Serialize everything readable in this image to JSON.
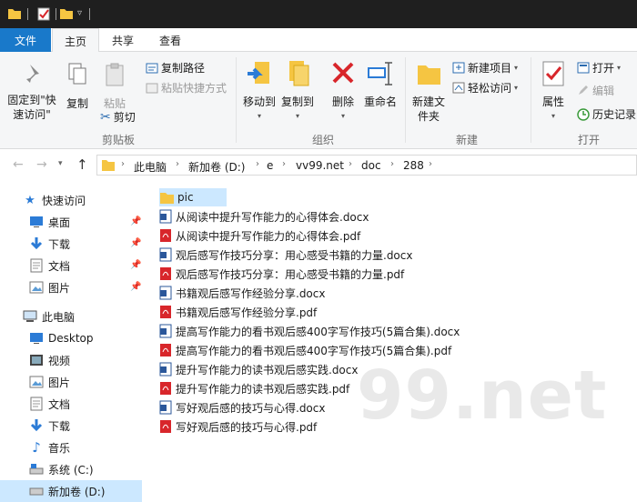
{
  "ribbon_tabs": {
    "file": "文件",
    "home": "主页",
    "share": "共享",
    "view": "查看"
  },
  "ribbon": {
    "pin_quick_access": "固定到\"快速访问\"",
    "copy": "复制",
    "paste": "粘贴",
    "copy_path": "复制路径",
    "paste_shortcut": "粘贴快捷方式",
    "cut": "剪切",
    "clipboard_group": "剪贴板",
    "move_to": "移动到",
    "copy_to": "复制到",
    "delete": "删除",
    "rename": "重命名",
    "organize_group": "组织",
    "new_folder": "新建文件夹",
    "new_item": "新建项目",
    "easy_access": "轻松访问",
    "new_group": "新建",
    "properties": "属性",
    "open": "打开",
    "edit": "编辑",
    "history": "历史记录",
    "open_group": "打开"
  },
  "address": {
    "crumbs": [
      "此电脑",
      "新加卷 (D:)",
      "e",
      "vv99.net",
      "doc",
      "288"
    ]
  },
  "nav": {
    "quick_access": "快速访问",
    "quick_items": [
      "桌面",
      "下载",
      "文档",
      "图片"
    ],
    "this_pc": "此电脑",
    "pc_items": [
      "Desktop",
      "视频",
      "图片",
      "文档",
      "下载",
      "音乐",
      "系统 (C:)",
      "新加卷 (D:)"
    ]
  },
  "files": [
    {
      "name": "pic",
      "type": "folder"
    },
    {
      "name": "从阅读中提升写作能力的心得体会.docx",
      "type": "docx"
    },
    {
      "name": "从阅读中提升写作能力的心得体会.pdf",
      "type": "pdf"
    },
    {
      "name": "观后感写作技巧分享：用心感受书籍的力量.docx",
      "type": "docx"
    },
    {
      "name": "观后感写作技巧分享：用心感受书籍的力量.pdf",
      "type": "pdf"
    },
    {
      "name": "书籍观后感写作经验分享.docx",
      "type": "docx"
    },
    {
      "name": "书籍观后感写作经验分享.pdf",
      "type": "pdf"
    },
    {
      "name": "提高写作能力的看书观后感400字写作技巧(5篇合集).docx",
      "type": "docx"
    },
    {
      "name": "提高写作能力的看书观后感400字写作技巧(5篇合集).pdf",
      "type": "pdf"
    },
    {
      "name": "提升写作能力的读书观后感实践.docx",
      "type": "docx"
    },
    {
      "name": "提升写作能力的读书观后感实践.pdf",
      "type": "pdf"
    },
    {
      "name": "写好观后感的技巧与心得.docx",
      "type": "docx"
    },
    {
      "name": "写好观后感的技巧与心得.pdf",
      "type": "pdf"
    }
  ],
  "watermark": "99.net",
  "colors": {
    "accent": "#1979ca",
    "selection": "#cce8ff",
    "folder": "#f5c542",
    "pdf": "#d8262b",
    "docx": "#2b579a"
  }
}
